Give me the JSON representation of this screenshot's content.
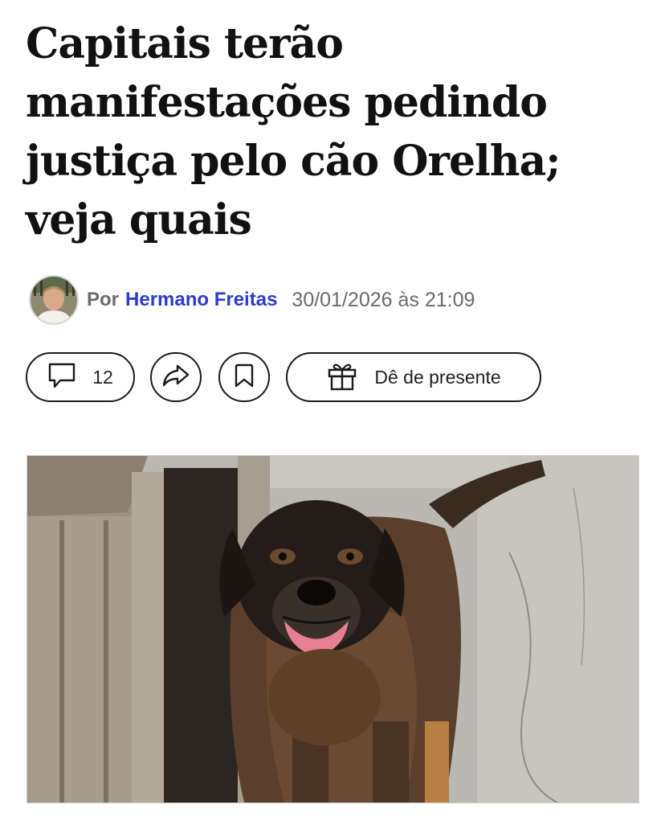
{
  "article": {
    "title": "Capitais terão manifestações pedindo justiça pelo cão Orelha; veja quais"
  },
  "byline": {
    "prefix": "Por",
    "author": "Hermano Freitas",
    "date": "30/01/2026 às 21:09"
  },
  "actions": {
    "comments_icon": "comment-icon",
    "comments_count": "12",
    "share_icon": "share-icon",
    "bookmark_icon": "bookmark-icon",
    "gift_icon": "gift-icon",
    "gift_label": "Dê de presente"
  },
  "colors": {
    "author_link": "#2d3bd0",
    "text": "#111111",
    "muted": "#6b6b6b"
  }
}
